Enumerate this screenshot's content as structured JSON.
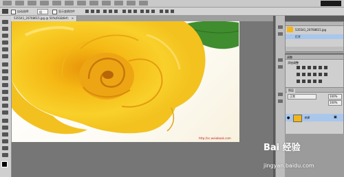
{
  "document_tab": {
    "title": "535541_20708615.jpg @ 50%(RGB/8#)",
    "close_glyph": "×"
  },
  "options_bar": {
    "auto_select_label": "自动选择:",
    "auto_select_value": "组",
    "transform_label": "显示变换控件"
  },
  "image": {
    "watermark": "http://sc.weiabook.com"
  },
  "history_panel": {
    "snapshot_name": "535541_20708615.jpg",
    "step_label": "打开"
  },
  "adjustments_panel": {
    "title": "调整",
    "subtitle": "添加调整"
  },
  "layers_panel": {
    "tab_label": "图层",
    "blend_mode": "正常",
    "opacity": "100%",
    "fill": "100%",
    "layer_name": "背景"
  },
  "overlay": {
    "brand": "Bai 经验",
    "url": "jingyan.baidu.com"
  },
  "colors": {
    "accent_selected": "#a9c6ec",
    "watermark_red": "#c01818",
    "rose_yellow": "#f6c718"
  }
}
